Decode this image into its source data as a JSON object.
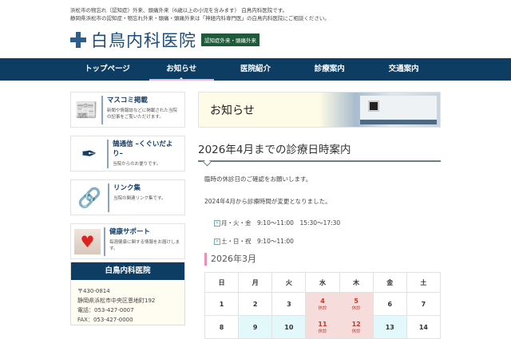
{
  "header": {
    "intro_lines": [
      "浜松市の物忘れ（認知症）外来、頭痛外来（6歳以上の小児を含みます） 白鳥内科医院です。",
      "静岡県浜松市の認知症・物忘れ外来・頭痛・頭痛外来は「神経内科専門医」の白鳥内科医院にご相談ください。"
    ],
    "logo_name": "白鳥内科医院",
    "logo_badge": "認知症外来・頭痛外来"
  },
  "nav": [
    {
      "label": "トップページ"
    },
    {
      "label": "お知らせ",
      "active": true
    },
    {
      "label": "医院紹介"
    },
    {
      "label": "診療案内"
    },
    {
      "label": "交通案内"
    }
  ],
  "sidebar": {
    "cards": [
      {
        "title": "マスコミ掲載",
        "desc": "新聞や情報誌などに掲載された当院の記事をご覧いただけます。",
        "icon": "newspaper-icon"
      },
      {
        "title": "鵠通信 –くぐいだより–",
        "desc": "当院からのお便りです。",
        "icon": "letter-quill-icon"
      },
      {
        "title": "リンク集",
        "desc": "当院の関連リンク集です。",
        "icon": "link-icon"
      },
      {
        "title": "健康サポート",
        "desc": "毎週健康に関する情報をお届けします。",
        "icon": "heart-hands-image"
      }
    ],
    "clinic": {
      "name": "白鳥内科医院",
      "postal": "〒430-0814",
      "address": "静岡県浜松市中央区恩地町192",
      "tel": "電話：053-427-0007",
      "fax": "FAX：053-427-0000"
    }
  },
  "main": {
    "banner_title": "お知らせ",
    "heading": "2026年4月までの診療日時案内",
    "p1": "臨時の休診日のご確認をお願いします。",
    "p2": "2024年4月から診療時間が変更となりました。",
    "hours": [
      "月・火・金　9:10～11:00　15:30～17:30",
      "土・日・祝　9:10～11:00"
    ],
    "calendar": {
      "title": "2026年3月",
      "weekdays": [
        "日",
        "月",
        "火",
        "水",
        "木",
        "金",
        "土"
      ],
      "closed_label": "休診",
      "rows": [
        [
          {
            "d": "1"
          },
          {
            "d": "2"
          },
          {
            "d": "3"
          },
          {
            "d": "4",
            "closed": true
          },
          {
            "d": "5",
            "closed": true
          },
          {
            "d": "6"
          },
          {
            "d": "7"
          }
        ],
        [
          {
            "d": "8"
          },
          {
            "d": "9",
            "cy": true
          },
          {
            "d": "10",
            "cy": true
          },
          {
            "d": "11",
            "closed": true
          },
          {
            "d": "12",
            "closed": true
          },
          {
            "d": "13",
            "cy": true
          },
          {
            "d": "14"
          }
        ]
      ]
    }
  }
}
